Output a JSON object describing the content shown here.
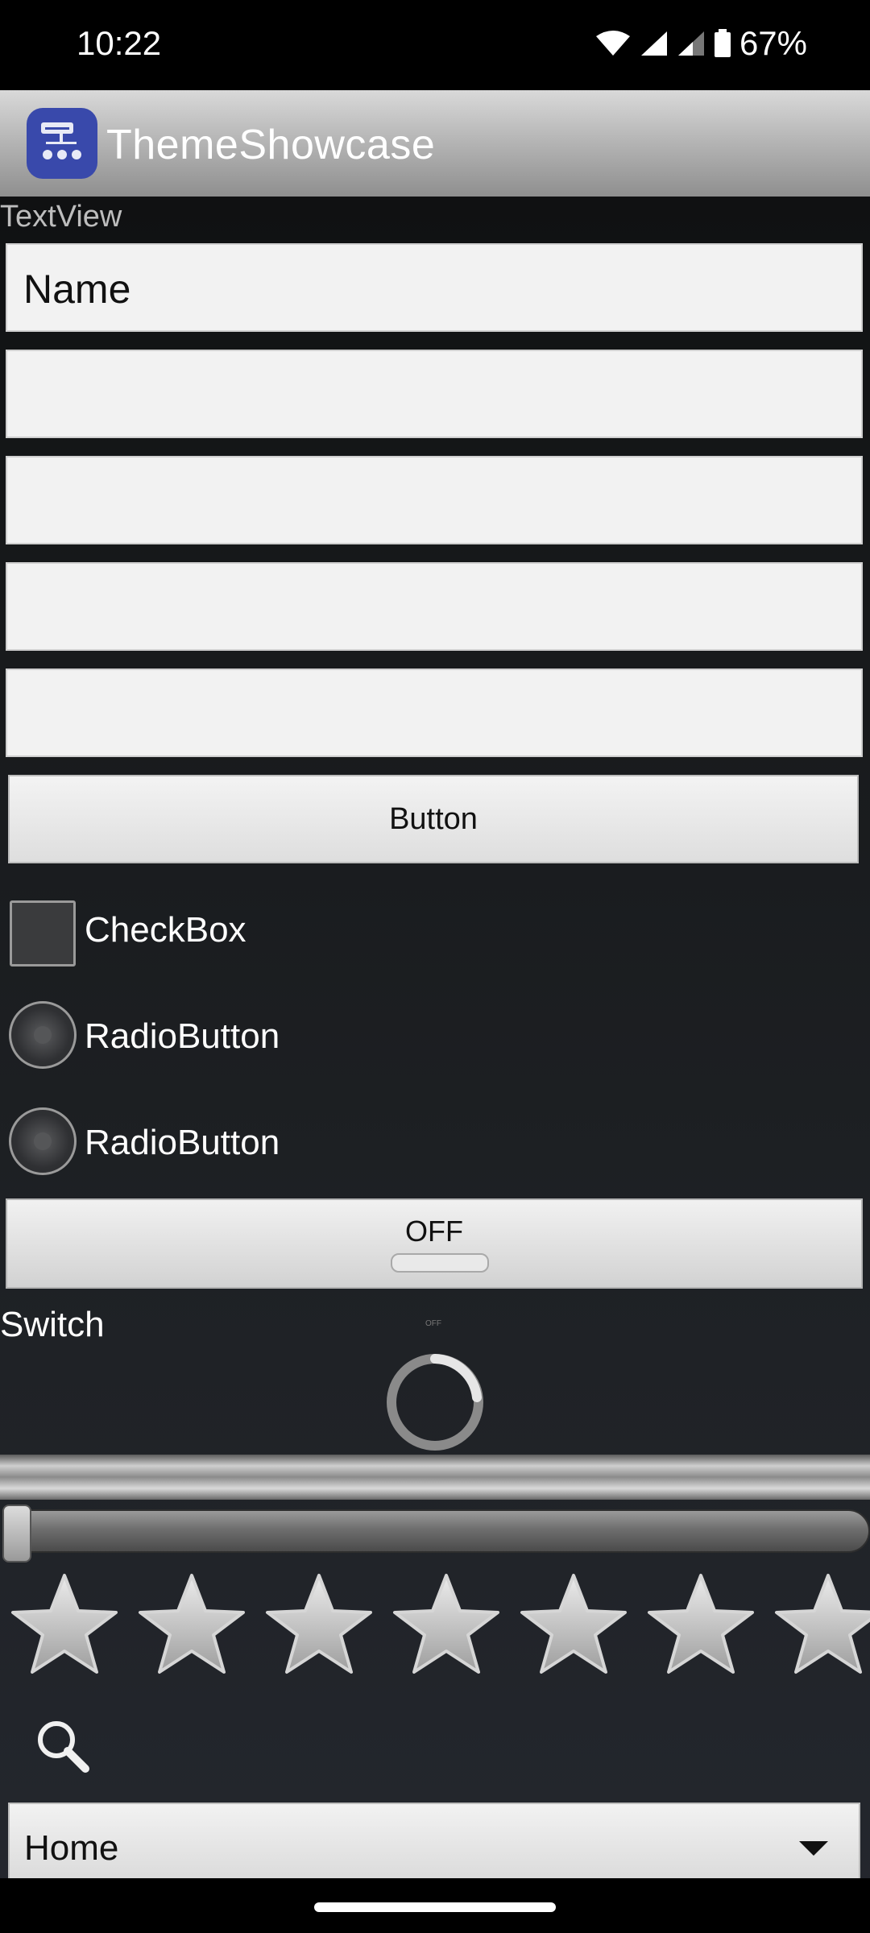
{
  "status": {
    "time": "10:22",
    "battery": "67%"
  },
  "app": {
    "title": "ThemeShowcase"
  },
  "content": {
    "textview_label": "TextView",
    "name_field_value": "Name",
    "button_label": "Button",
    "checkbox_label": "CheckBox",
    "radio_labels": [
      "RadioButton",
      "RadioButton"
    ],
    "toggle_label": "OFF",
    "switch_label": "Switch",
    "switch_state_mini": "OFF",
    "seekbar_progress": 0,
    "rating": 0,
    "rating_max": 7,
    "spinner_value": "Home"
  }
}
